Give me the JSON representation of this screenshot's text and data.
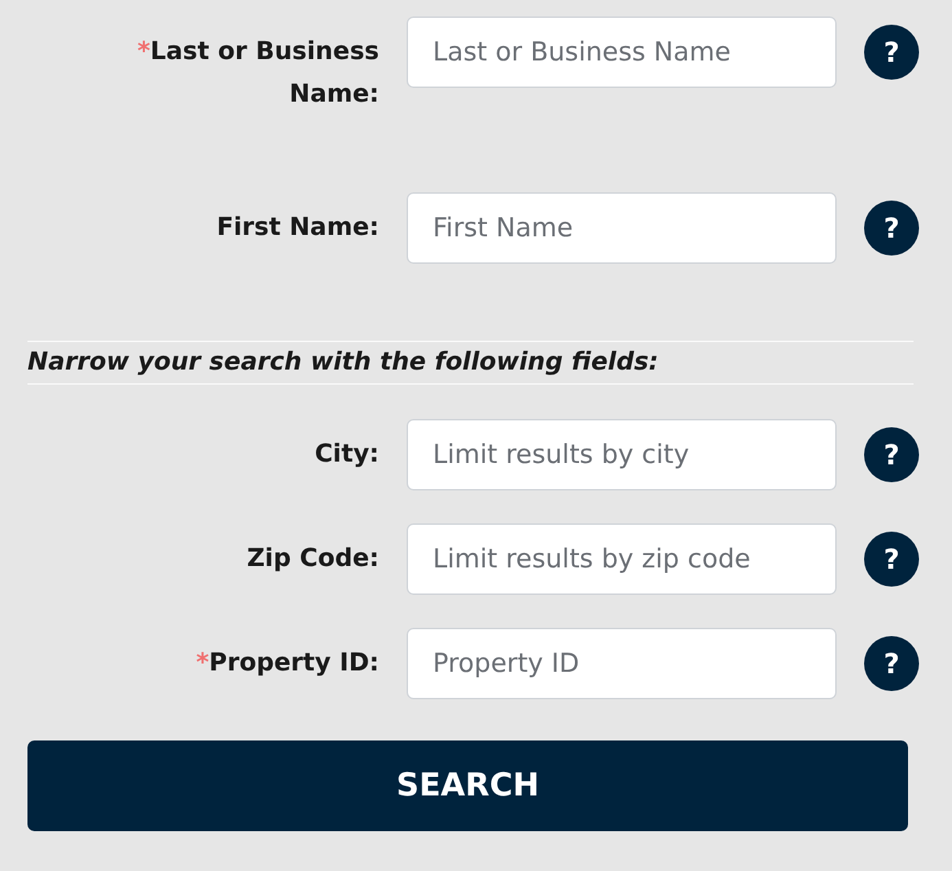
{
  "required_mark": "*",
  "name_fields": [
    {
      "label": "Last or Business Name:",
      "placeholder": "Last or Business Name",
      "required": true,
      "help": "?"
    },
    {
      "label": "First Name:",
      "placeholder": "First Name",
      "required": false,
      "help": "?"
    }
  ],
  "narrow_heading": "Narrow your search with the following fields:",
  "filter_fields": [
    {
      "label": "City:",
      "placeholder": "Limit results by city",
      "required": false,
      "help": "?"
    },
    {
      "label": "Zip Code:",
      "placeholder": "Limit results by zip code",
      "required": false,
      "help": "?"
    },
    {
      "label": "Property ID:",
      "placeholder": "Property ID",
      "required": true,
      "help": "?"
    }
  ],
  "button": "SEARCH"
}
